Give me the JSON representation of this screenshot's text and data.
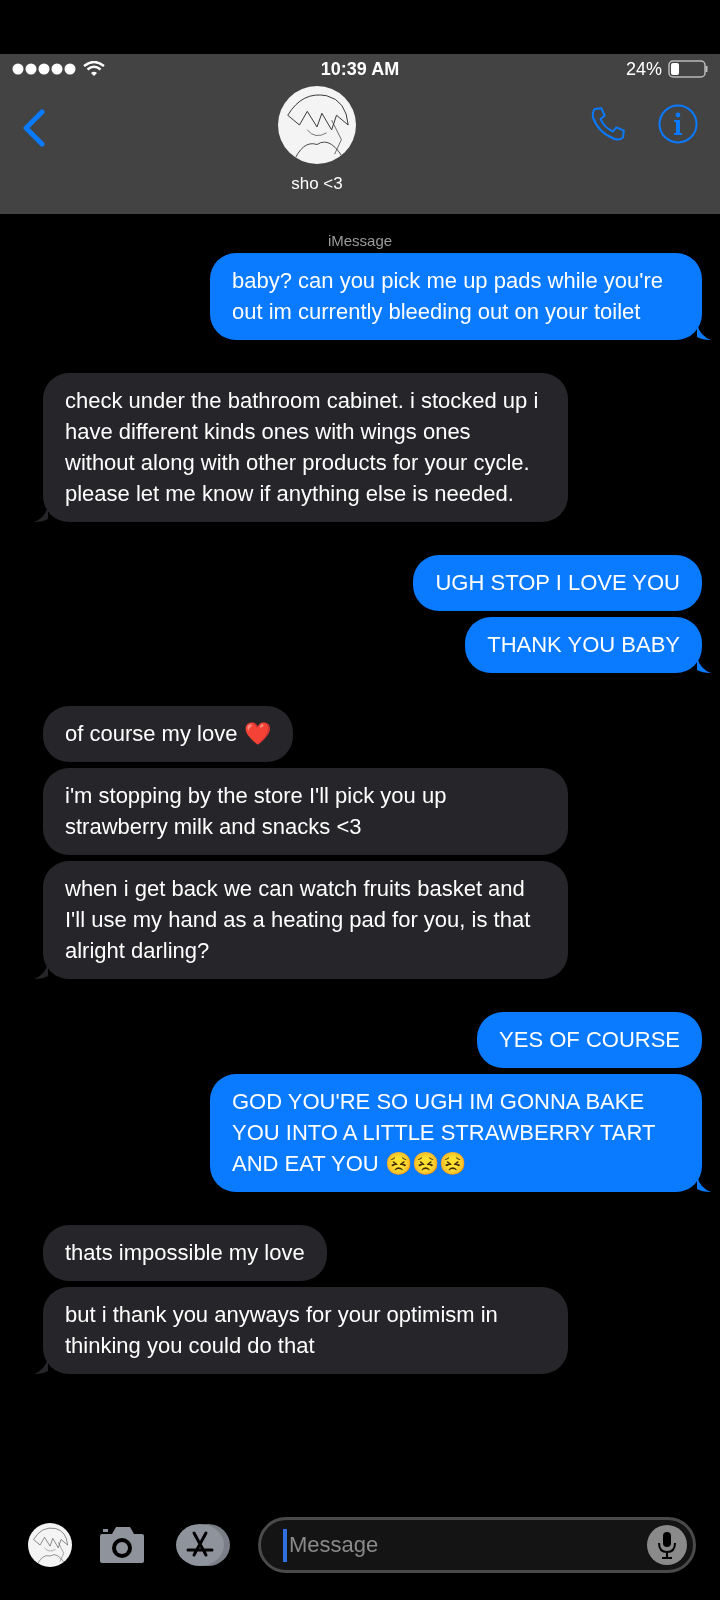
{
  "status_bar": {
    "time": "10:39 AM",
    "battery": "24%"
  },
  "contact": {
    "name": "sho <3"
  },
  "service_label": "iMessage",
  "groups": [
    {
      "kind": "sent",
      "messages": [
        "baby? can you pick me up pads while you're out im currently bleeding out on your toilet"
      ]
    },
    {
      "kind": "received",
      "messages": [
        "check under the bathroom cabinet. i stocked up i have different kinds ones with wings ones without along with other products for your cycle. please let me know if anything else is needed."
      ]
    },
    {
      "kind": "sent",
      "messages": [
        "UGH STOP I LOVE YOU",
        "THANK YOU BABY"
      ]
    },
    {
      "kind": "received",
      "messages": [
        "of course my love ❤️",
        "i'm stopping by the store I'll pick you up strawberry milk and snacks <3",
        "when i get back we can watch fruits basket and I'll use my hand as a heating pad for you, is that alright darling?"
      ]
    },
    {
      "kind": "sent",
      "messages": [
        "YES OF COURSE",
        "GOD YOU'RE SO UGH IM GONNA BAKE YOU INTO A LITTLE STRAWBERRY TART AND EAT YOU 😣😣😣"
      ]
    },
    {
      "kind": "received",
      "messages": [
        "thats impossible my love",
        "but i thank you anyways for your optimism in thinking you could do that"
      ]
    }
  ],
  "composer": {
    "placeholder": "Message"
  }
}
